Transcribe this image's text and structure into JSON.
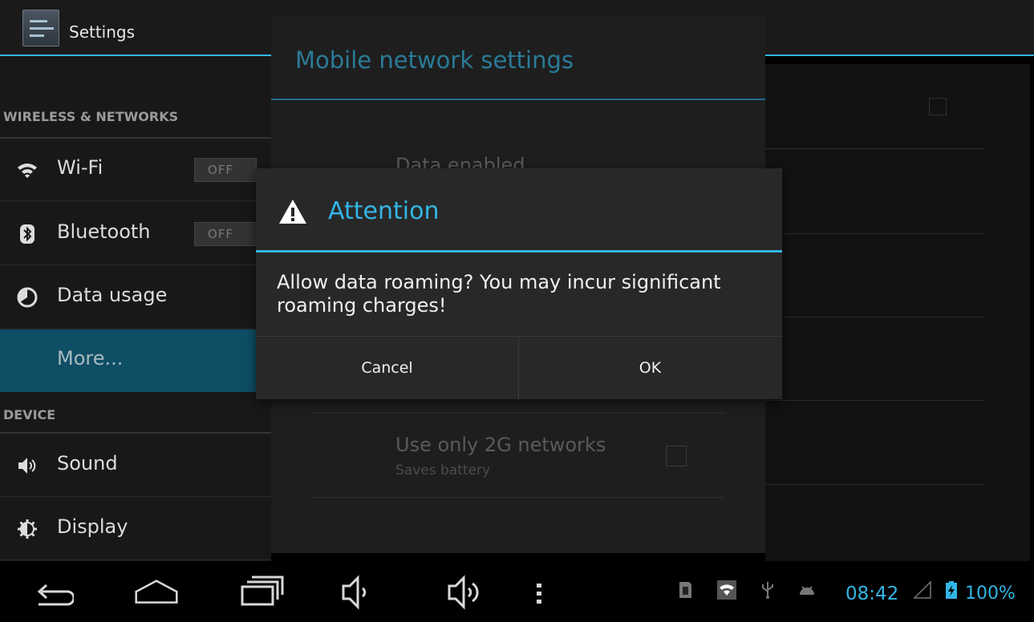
{
  "app": {
    "title": "Settings"
  },
  "sidebar": {
    "sections": {
      "wireless": "WIRELESS & NETWORKS",
      "device": "DEVICE"
    },
    "items": [
      {
        "label": "Wi-Fi",
        "icon": "wifi-icon",
        "toggle": "OFF"
      },
      {
        "label": "Bluetooth",
        "icon": "bluetooth-icon",
        "toggle": "OFF"
      },
      {
        "label": "Data usage",
        "icon": "data-usage-icon"
      },
      {
        "label": "More...",
        "selected": true
      },
      {
        "label": "Sound",
        "icon": "speaker-icon"
      },
      {
        "label": "Display",
        "icon": "display-icon"
      }
    ]
  },
  "mobile_network_dialog": {
    "title": "Mobile network settings",
    "items": [
      {
        "title": "Data enabled"
      },
      {
        "title": "Use only 2G networks",
        "subtitle": "Saves battery",
        "checked": false
      }
    ]
  },
  "alert": {
    "icon": "warning-icon",
    "title": "Attention",
    "message": "Allow data roaming? You may incur significant roaming charges!",
    "cancel_label": "Cancel",
    "ok_label": "OK"
  },
  "status_bar": {
    "time": "08:42",
    "battery": "100%"
  },
  "colors": {
    "accent": "#33b5e5",
    "selected_row": "#0e4f66",
    "background": "#000000"
  }
}
